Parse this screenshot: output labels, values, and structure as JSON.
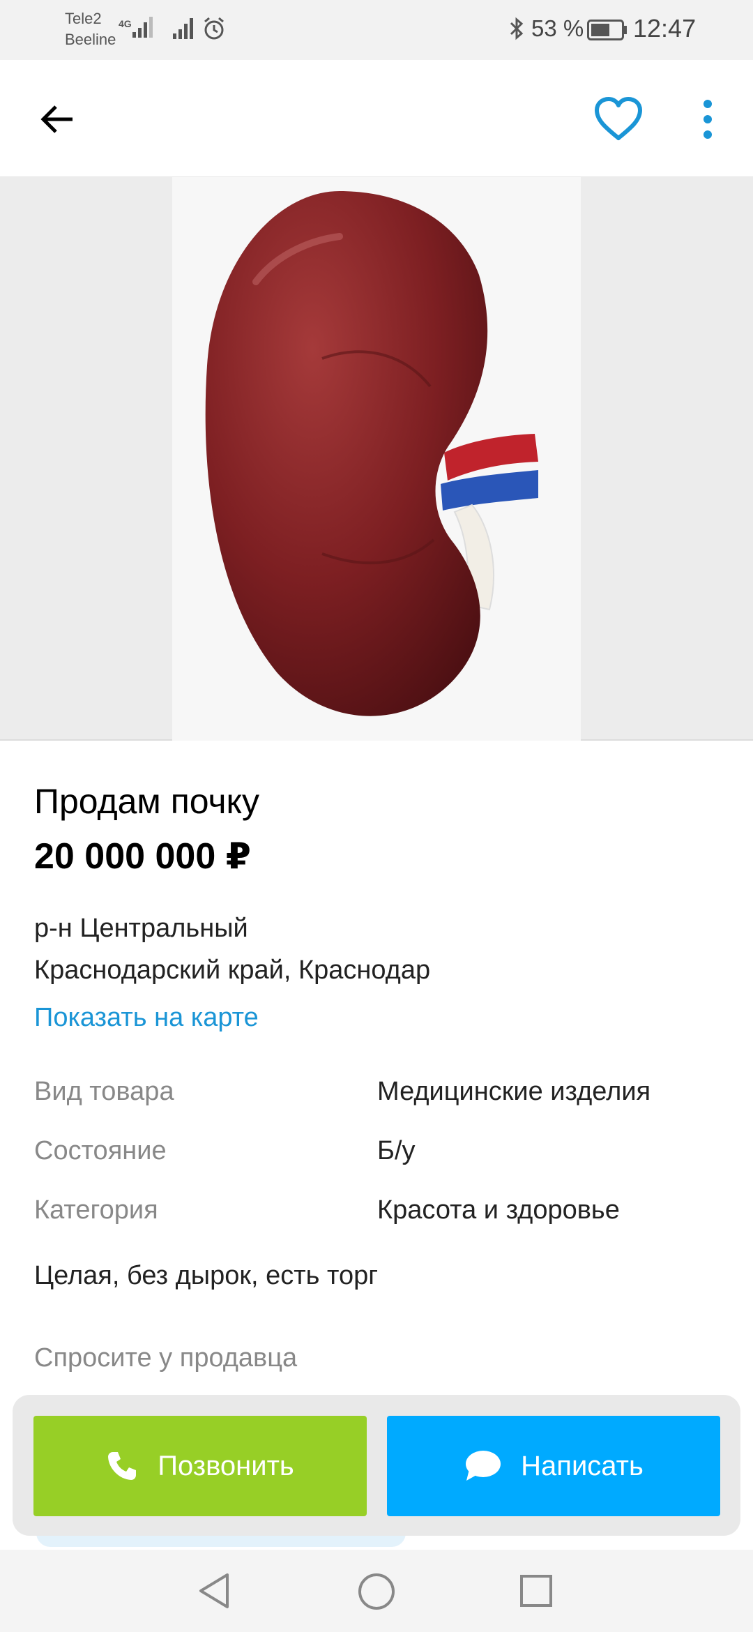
{
  "status_bar": {
    "carrier1": "Tele2",
    "carrier2": "Beeline",
    "network": "4G",
    "battery": "53 %",
    "time": "12:47"
  },
  "header": {
    "back_icon": "arrow-left",
    "favorite_icon": "heart-outline",
    "more_icon": "more-vertical",
    "accent_color": "#1a95d6"
  },
  "listing": {
    "title": "Продам почку",
    "price": "20 000 000 ₽",
    "district": "р-н Центральный",
    "region": "Краснодарский край, Краснодар",
    "map_link": "Показать на карте",
    "params": [
      {
        "label": "Вид товара",
        "value": "Медицинские изделия"
      },
      {
        "label": "Состояние",
        "value": "Б/у"
      },
      {
        "label": "Категория",
        "value": "Красота и здоровье"
      }
    ],
    "description": "Целая, без дырок, есть торг",
    "ask_seller": "Спросите у продавца"
  },
  "actions": {
    "call_label": "Позвонить",
    "call_color": "#97cf26",
    "write_label": "Написать",
    "write_color": "#00aaff"
  },
  "nav": {
    "back_icon": "triangle-back",
    "home_icon": "circle-home",
    "recent_icon": "square-recent"
  }
}
